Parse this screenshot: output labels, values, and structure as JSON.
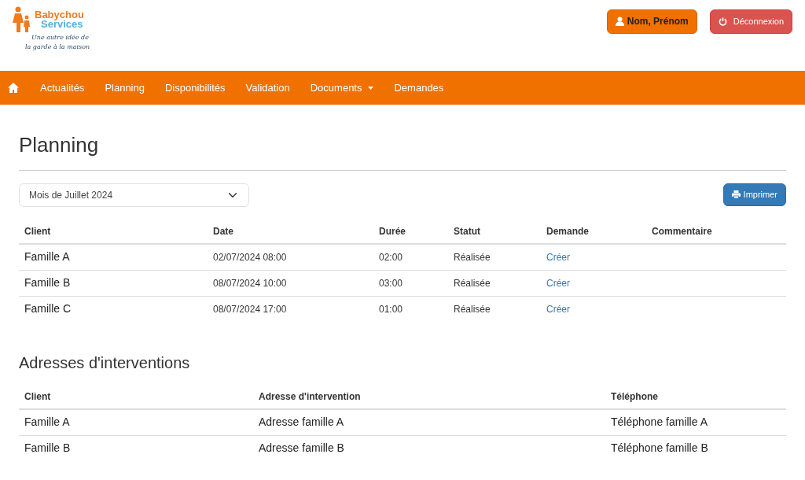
{
  "logo": {
    "brand_line1": "Babychou",
    "brand_line2": "Services",
    "tagline_line1": "Une autre idée de",
    "tagline_line2": "la garde à la maison"
  },
  "header_buttons": {
    "user": "Nom, Prénom",
    "logout": "Déconnexion"
  },
  "nav": {
    "items": [
      {
        "label": "Actualités",
        "dropdown": false
      },
      {
        "label": "Planning",
        "dropdown": false
      },
      {
        "label": "Disponibilités",
        "dropdown": false
      },
      {
        "label": "Validation",
        "dropdown": false
      },
      {
        "label": "Documents",
        "dropdown": true
      },
      {
        "label": "Demandes",
        "dropdown": false
      }
    ]
  },
  "page_title": "Planning",
  "month_select": {
    "value": "Mois de Juillet 2024"
  },
  "print_button": "Imprimer",
  "planning_table": {
    "columns": [
      "Client",
      "Date",
      "Durée",
      "Statut",
      "Demande",
      "Commentaire"
    ],
    "rows": [
      [
        "Famille A",
        "02/07/2024 08:00",
        "02:00",
        "Réalisée",
        "Créer"
      ],
      [
        "Famille B",
        "08/07/2024 10:00",
        "03:00",
        "Réalisée",
        "Créer"
      ],
      [
        "Famille C",
        "08/07/2024 17:00",
        "01:00",
        "Réalisée",
        "Créer"
      ]
    ]
  },
  "addresses_title": "Adresses d'interventions",
  "addresses_table": {
    "columns": [
      "Client",
      "Adresse d'intervention",
      "Téléphone"
    ],
    "rows": [
      [
        "Famille A",
        "Adresse famille A",
        "Téléphone famille A"
      ],
      [
        "Famille B",
        "Adresse famille B",
        "Téléphone famille B"
      ]
    ]
  }
}
